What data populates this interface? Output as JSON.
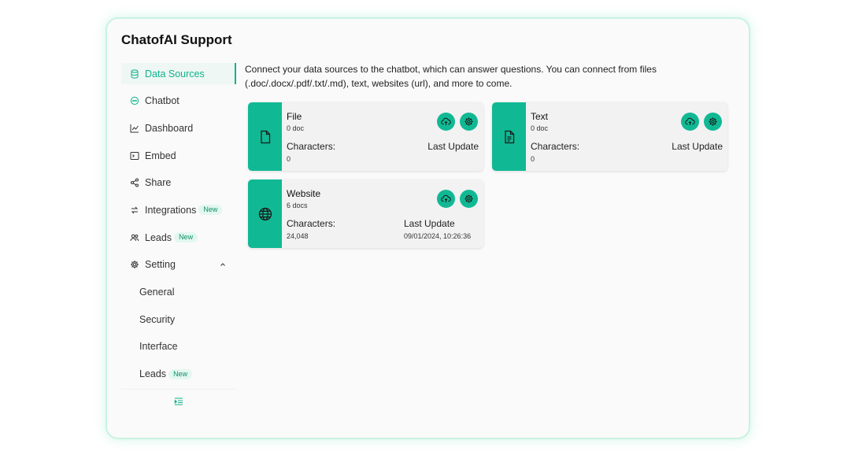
{
  "app": {
    "title": "ChatofAI Support"
  },
  "sidebar": {
    "items": [
      {
        "label": "Data Sources",
        "icon": "database-icon",
        "active": true
      },
      {
        "label": "Chatbot",
        "icon": "chat-bubble-icon"
      },
      {
        "label": "Dashboard",
        "icon": "line-chart-icon"
      },
      {
        "label": "Embed",
        "icon": "terminal-icon"
      },
      {
        "label": "Share",
        "icon": "share-icon"
      },
      {
        "label": "Integrations",
        "icon": "integrations-icon",
        "badge": "New"
      },
      {
        "label": "Leads",
        "icon": "users-icon",
        "badge": "New"
      },
      {
        "label": "Setting",
        "icon": "gear-icon",
        "expanded": true
      }
    ],
    "setting_sub": [
      {
        "label": "General"
      },
      {
        "label": "Security"
      },
      {
        "label": "Interface"
      },
      {
        "label": "Leads",
        "badge": "New"
      }
    ],
    "collapse_icon": "indent-icon"
  },
  "main": {
    "description": "Connect your data sources to the chatbot, which can answer questions. You can connect from files (.doc/.docx/.pdf/.txt/.md), text, websites (url), and more to come.",
    "cards": [
      {
        "title": "File",
        "count": "0 doc",
        "characters_label": "Characters:",
        "characters_value": "0",
        "update_label": "Last Update",
        "update_value": "",
        "icon": "file-icon"
      },
      {
        "title": "Text",
        "count": "0 doc",
        "characters_label": "Characters:",
        "characters_value": "0",
        "update_label": "Last Update",
        "update_value": "",
        "icon": "text-file-icon"
      },
      {
        "title": "Website",
        "count": "6 docs",
        "characters_label": "Characters:",
        "characters_value": "24,048",
        "update_label": "Last Update",
        "update_value": "09/01/2024, 10:26:36",
        "icon": "globe-icon"
      }
    ]
  },
  "colors": {
    "accent": "#10b994",
    "active_bg": "#eef7f4",
    "card_bg": "#f2f2f2",
    "panel_border": "#c8f3e1"
  }
}
